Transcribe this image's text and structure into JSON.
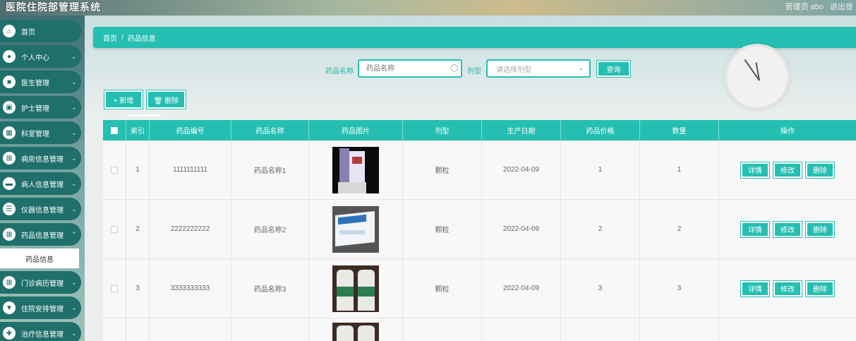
{
  "header": {
    "title": "医院住院部管理系统",
    "user": "管理员 abo",
    "logout": "退出登"
  },
  "sidebar": {
    "items": [
      {
        "label": "首页",
        "icon": "home-icon"
      },
      {
        "label": "个人中心",
        "icon": "user-icon"
      },
      {
        "label": "医生管理",
        "icon": "doctor-icon"
      },
      {
        "label": "护士管理",
        "icon": "nurse-icon"
      },
      {
        "label": "科室管理",
        "icon": "department-icon"
      },
      {
        "label": "病房信息管理",
        "icon": "ward-icon"
      },
      {
        "label": "病人信息管理",
        "icon": "patient-icon"
      },
      {
        "label": "仪器信息管理",
        "icon": "instrument-icon"
      },
      {
        "label": "药品信息管理",
        "icon": "medicine-icon"
      },
      {
        "label": "门诊病历管理",
        "icon": "record-icon"
      },
      {
        "label": "住院安排管理",
        "icon": "arrange-icon"
      },
      {
        "label": "治疗信息管理",
        "icon": "treatment-icon"
      }
    ],
    "active_sub": "药品信息"
  },
  "breadcrumb": {
    "home": "首页",
    "sep": "/",
    "current": "药品信息"
  },
  "search": {
    "name_label": "药品名称",
    "name_placeholder": "药品名称",
    "type_label": "剂型",
    "type_placeholder": "请选择剂型",
    "query_button": "查询"
  },
  "toolbar": {
    "add_label": "+ 新增",
    "delete_label": "🗑 删除"
  },
  "table": {
    "columns": [
      "索引",
      "药品编号",
      "药品名称",
      "药品图片",
      "剂型",
      "生产日期",
      "药品价格",
      "数量",
      "操作"
    ],
    "rows": [
      {
        "index": "1",
        "code": "1111111111",
        "name": "药品名称1",
        "type": "颗粒",
        "date": "2022-04-09",
        "price": "1",
        "qty": "1"
      },
      {
        "index": "2",
        "code": "2222222222",
        "name": "药品名称2",
        "type": "颗粒",
        "date": "2022-04-09",
        "price": "2",
        "qty": "2"
      },
      {
        "index": "3",
        "code": "3333333333",
        "name": "药品名称3",
        "type": "颗粒",
        "date": "2022-04-09",
        "price": "3",
        "qty": "3"
      }
    ],
    "actions": {
      "detail": "详情",
      "edit": "修改",
      "delete": "删除"
    }
  },
  "colors": {
    "accent": "#24bfb2",
    "sidebar": "#1f6f6a"
  }
}
